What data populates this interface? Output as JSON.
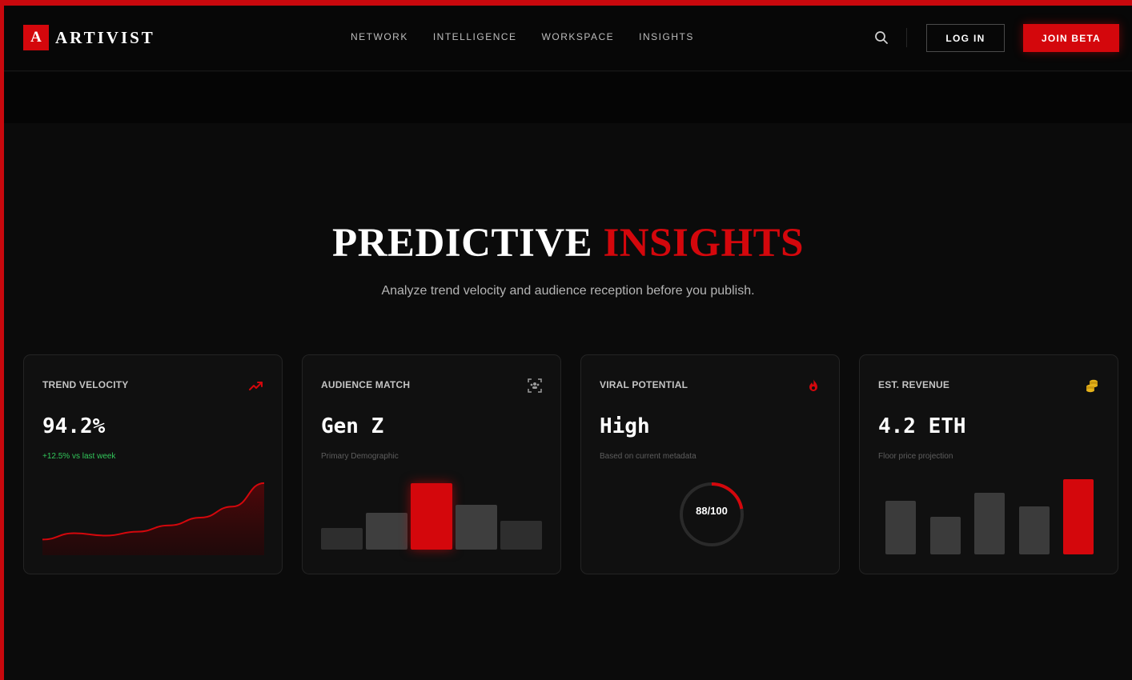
{
  "header": {
    "logo_mark": "A",
    "logo_text": "ARTIVIST",
    "nav": [
      "NETWORK",
      "INTELLIGENCE",
      "WORKSPACE",
      "INSIGHTS"
    ],
    "login_label": "LOG IN",
    "join_label": "JOIN BETA",
    "search_icon": "search-icon"
  },
  "hero": {
    "title_part1": "PREDICTIVE",
    "title_part2": "INSIGHTS",
    "subtitle": "Analyze trend velocity and audience reception before you publish."
  },
  "colors": {
    "accent": "#d4070c",
    "positive": "#32c65a",
    "coin": "#e5b21a",
    "bar_muted": "#3b3b3b"
  },
  "cards": [
    {
      "label": "TREND VELOCITY",
      "icon": "trending-up-icon",
      "value": "94.2%",
      "note": "+12.5% vs last week",
      "chart": {
        "type": "area",
        "values": [
          20,
          28,
          25,
          30,
          38,
          48,
          62,
          92
        ]
      }
    },
    {
      "label": "AUDIENCE MATCH",
      "icon": "audience-scan-icon",
      "value": "Gen Z",
      "note": "Primary Demographic",
      "chart": {
        "type": "bar",
        "values": [
          33,
          55,
          100,
          67,
          43
        ],
        "highlight": 2
      }
    },
    {
      "label": "VIRAL POTENTIAL",
      "icon": "flame-icon",
      "value": "High",
      "note": "Based on current metadata",
      "gauge": {
        "score": 88,
        "text": "88/100",
        "arc_fraction": 0.22
      }
    },
    {
      "label": "EST. REVENUE",
      "icon": "coins-icon",
      "value": "4.2 ETH",
      "note": "Floor price projection",
      "chart": {
        "type": "bar",
        "values": [
          71,
          50,
          82,
          64,
          100
        ],
        "highlight": 4
      }
    }
  ]
}
